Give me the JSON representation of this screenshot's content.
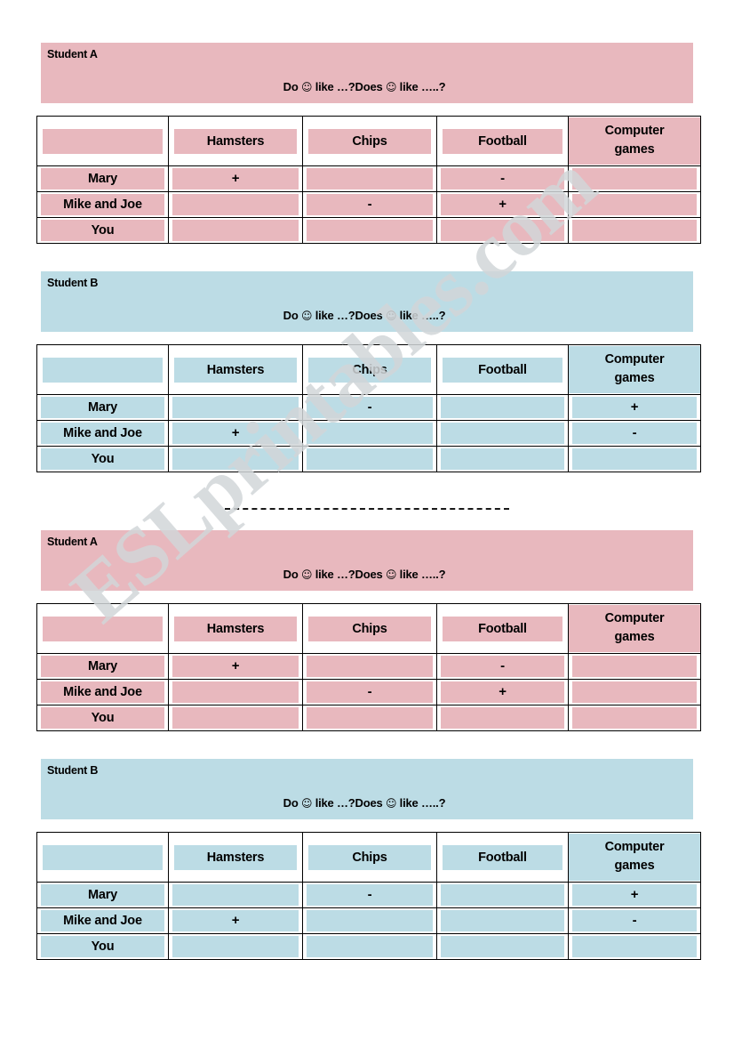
{
  "colors": {
    "pink": "#e8b8be",
    "blue": "#bcdce5",
    "text": "#000000",
    "watermark": "#d2d6d9"
  },
  "watermark": {
    "text": "ESLprintables.com"
  },
  "question_text": {
    "before": "Do ",
    "smiley1": "☺",
    "middle": " like …?Does ",
    "smiley2": "☺",
    "after": " like …..?"
  },
  "columns": {
    "blank": "",
    "hamsters": "Hamsters",
    "chips": "Chips",
    "football": "Football",
    "computer_games_line1": "Computer",
    "computer_games_line2": "games"
  },
  "rows": {
    "mary": "Mary",
    "mike_and_joe": "Mike and Joe",
    "you": "You"
  },
  "marks": {
    "plus": "+",
    "minus": "-",
    "empty": ""
  },
  "blocks": [
    {
      "id": "block-1",
      "label": "Student A",
      "variant": "pink",
      "table": {
        "headers": [
          "",
          "Hamsters",
          "Chips",
          "Football",
          "Computer games"
        ],
        "rows": [
          {
            "name": "Mary",
            "cells": [
              "+",
              "",
              "-",
              ""
            ]
          },
          {
            "name": "Mike and Joe",
            "cells": [
              "",
              "-",
              "+",
              ""
            ]
          },
          {
            "name": "You",
            "cells": [
              "",
              "",
              "",
              ""
            ]
          }
        ]
      }
    },
    {
      "id": "block-2",
      "label": "Student B",
      "variant": "blue",
      "table": {
        "headers": [
          "",
          "Hamsters",
          "Chips",
          "Football",
          "Computer games"
        ],
        "rows": [
          {
            "name": "Mary",
            "cells": [
              "",
              "-",
              "",
              "+"
            ]
          },
          {
            "name": "Mike and Joe",
            "cells": [
              "+",
              "",
              "",
              "-"
            ]
          },
          {
            "name": "You",
            "cells": [
              "",
              "",
              "",
              ""
            ]
          }
        ]
      }
    },
    {
      "id": "block-3",
      "label": "Student A",
      "variant": "pink",
      "table": {
        "headers": [
          "",
          "Hamsters",
          "Chips",
          "Football",
          "Computer games"
        ],
        "rows": [
          {
            "name": "Mary",
            "cells": [
              "+",
              "",
              "-",
              ""
            ]
          },
          {
            "name": "Mike and Joe",
            "cells": [
              "",
              "-",
              "+",
              ""
            ]
          },
          {
            "name": "You",
            "cells": [
              "",
              "",
              "",
              ""
            ]
          }
        ]
      }
    },
    {
      "id": "block-4",
      "label": "Student B",
      "variant": "blue",
      "table": {
        "headers": [
          "",
          "Hamsters",
          "Chips",
          "Football",
          "Computer games"
        ],
        "rows": [
          {
            "name": "Mary",
            "cells": [
              "",
              "-",
              "",
              "+"
            ]
          },
          {
            "name": "Mike and Joe",
            "cells": [
              "+",
              "",
              "",
              "-"
            ]
          },
          {
            "name": "You",
            "cells": [
              "",
              "",
              "",
              ""
            ]
          }
        ]
      }
    }
  ]
}
